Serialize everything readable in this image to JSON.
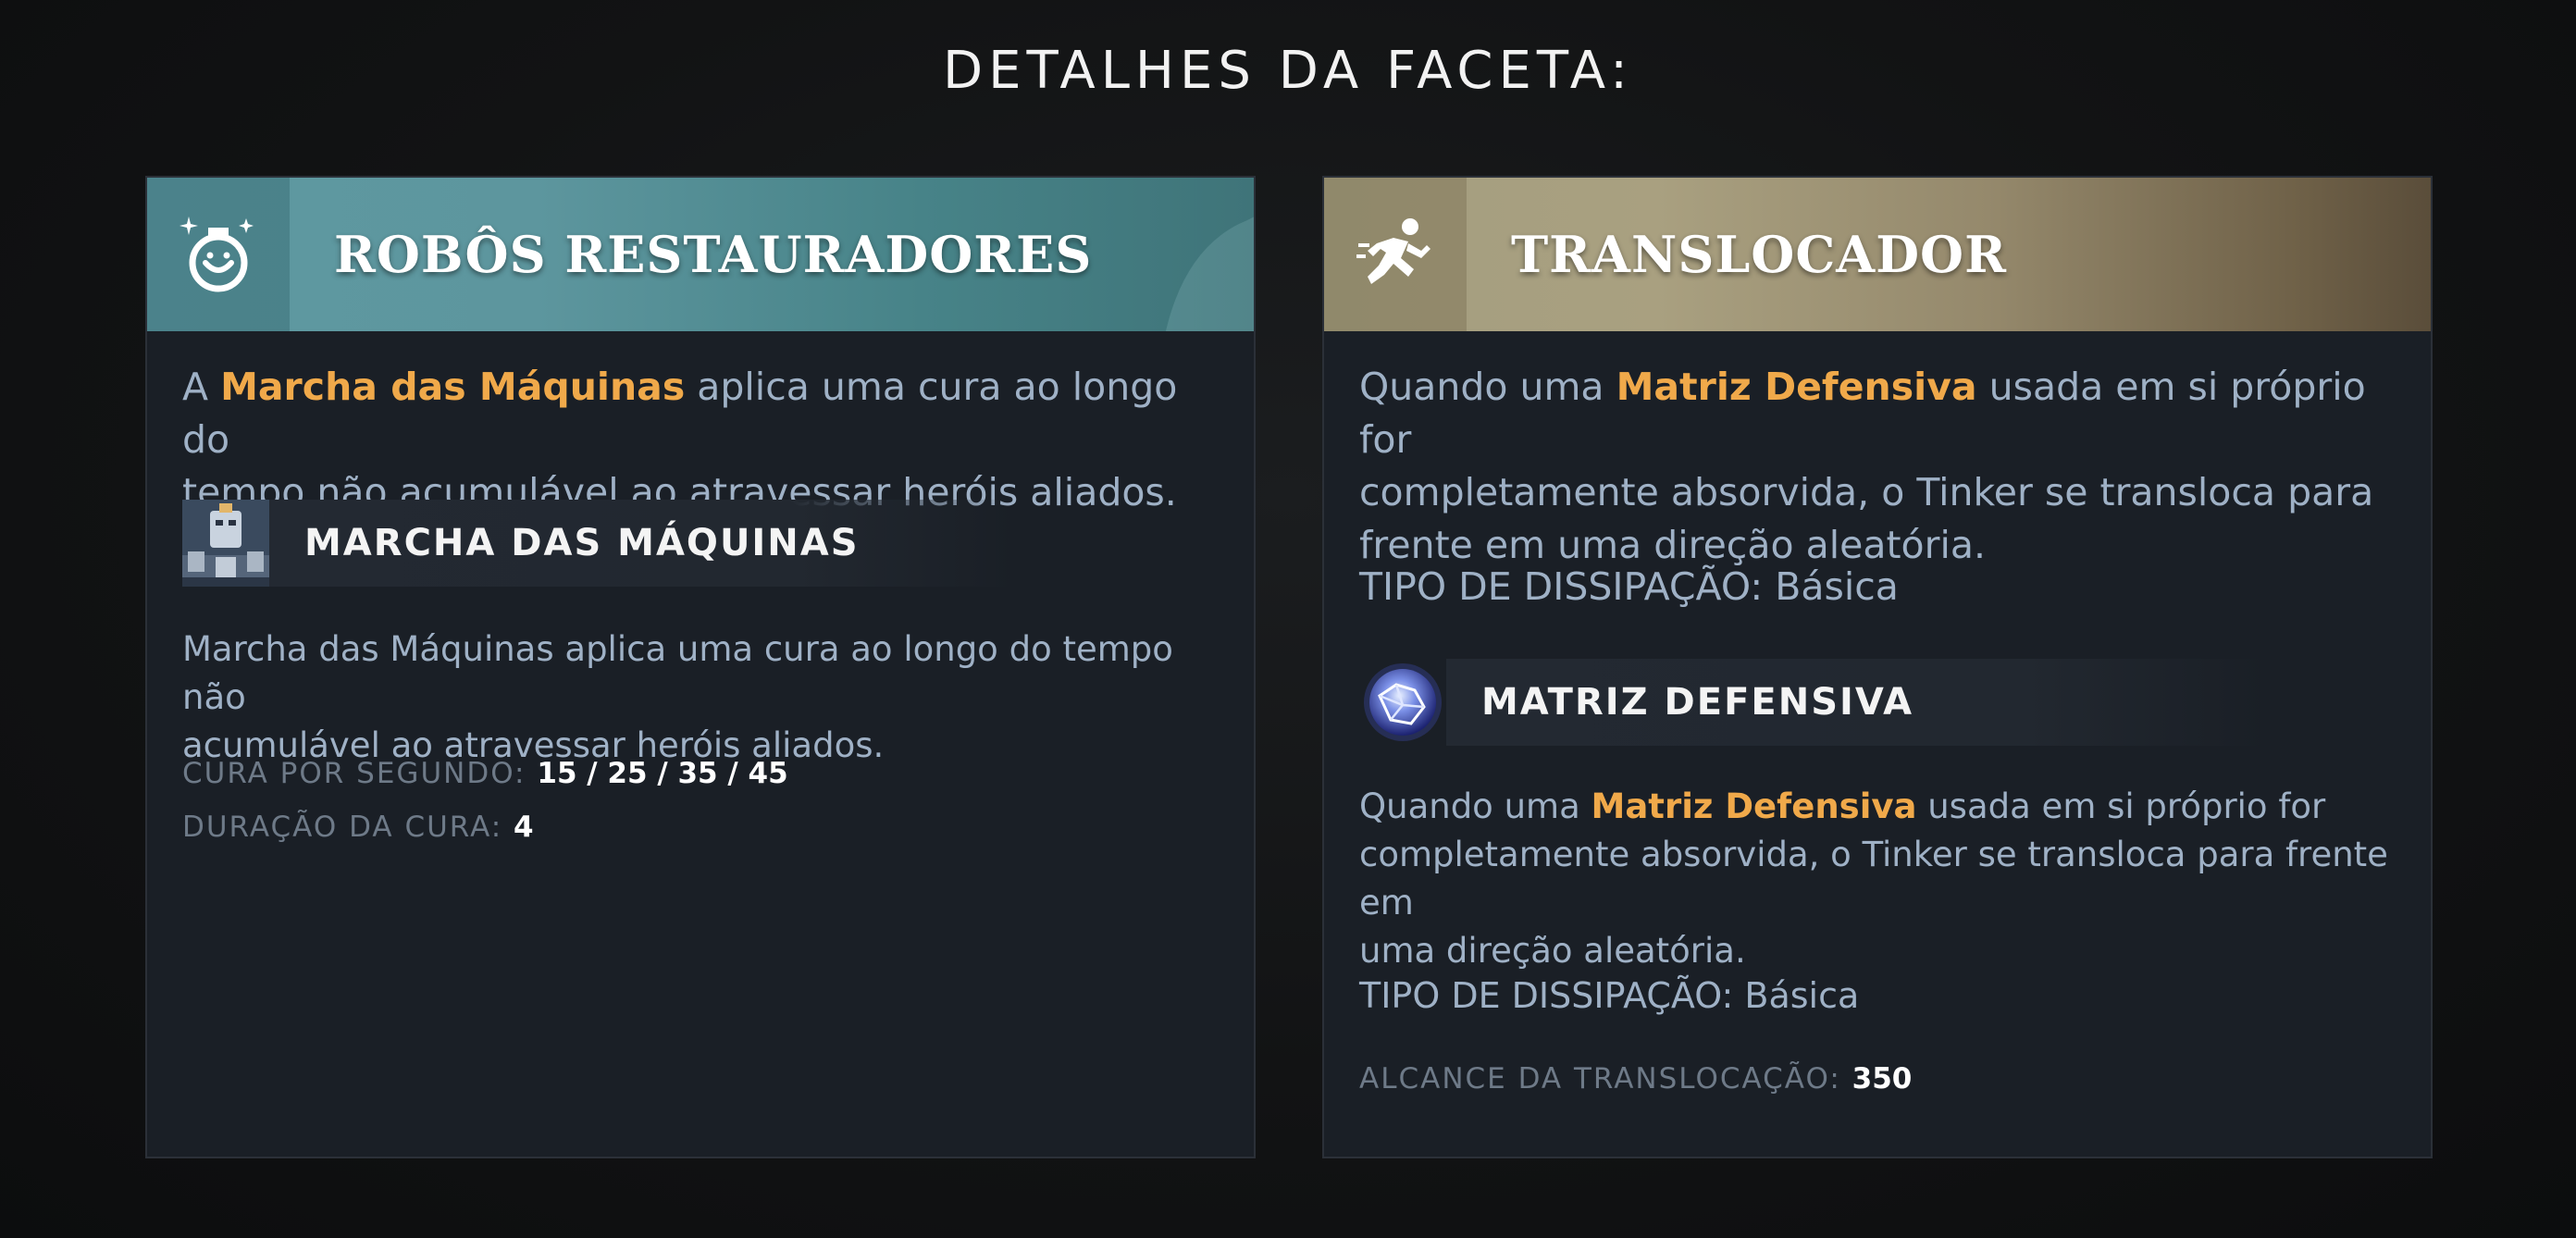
{
  "page_title": "DETALHES DA FACETA:",
  "facets": [
    {
      "icon": "potion-sparkle-icon",
      "accent_color": "#5e99a1",
      "title": "ROBÔS RESTAURADORES",
      "desc": {
        "pre": "A ",
        "highlight": "Marcha das Máquinas",
        "line1_post": " aplica uma cura ao longo do",
        "line2": "tempo não acumulável ao atravessar heróis aliados."
      },
      "ability": {
        "icon": "march-of-the-machines-icon",
        "name": "MARCHA DAS MÁQUINAS",
        "desc_line1": "Marcha das Máquinas aplica uma cura ao longo do tempo não",
        "desc_line2": "acumulável ao atravessar heróis aliados.",
        "stats": [
          {
            "label": "CURA POR SEGUNDO:",
            "value": "15 / 25 / 35 / 45"
          },
          {
            "label": "DURAÇÃO DA CURA:",
            "value": "4"
          }
        ]
      }
    },
    {
      "icon": "running-man-icon",
      "accent_color": "#a49e80",
      "title": "TRANSLOCADOR",
      "desc": {
        "pre": "Quando uma ",
        "highlight": "Matriz Defensiva",
        "line1_post": " usada em si próprio for",
        "line2": "completamente absorvida, o Tinker se transloca para",
        "line3": "frente em uma direção aleatória."
      },
      "dispel": "TIPO DE DISSIPAÇÃO: Básica",
      "ability": {
        "icon": "defense-matrix-icon",
        "name": "MATRIZ DEFENSIVA",
        "desc_pre": "Quando uma ",
        "desc_highlight": "Matriz Defensiva",
        "desc_line1_post": " usada em si próprio for",
        "desc_line2": "completamente absorvida, o Tinker se transloca para frente em",
        "desc_line3": "uma direção aleatória.",
        "dispel": "TIPO DE DISSIPAÇÃO: Básica",
        "stats": [
          {
            "label": "ALCANCE DA TRANSLOCAÇÃO:",
            "value": "350"
          }
        ]
      }
    }
  ]
}
